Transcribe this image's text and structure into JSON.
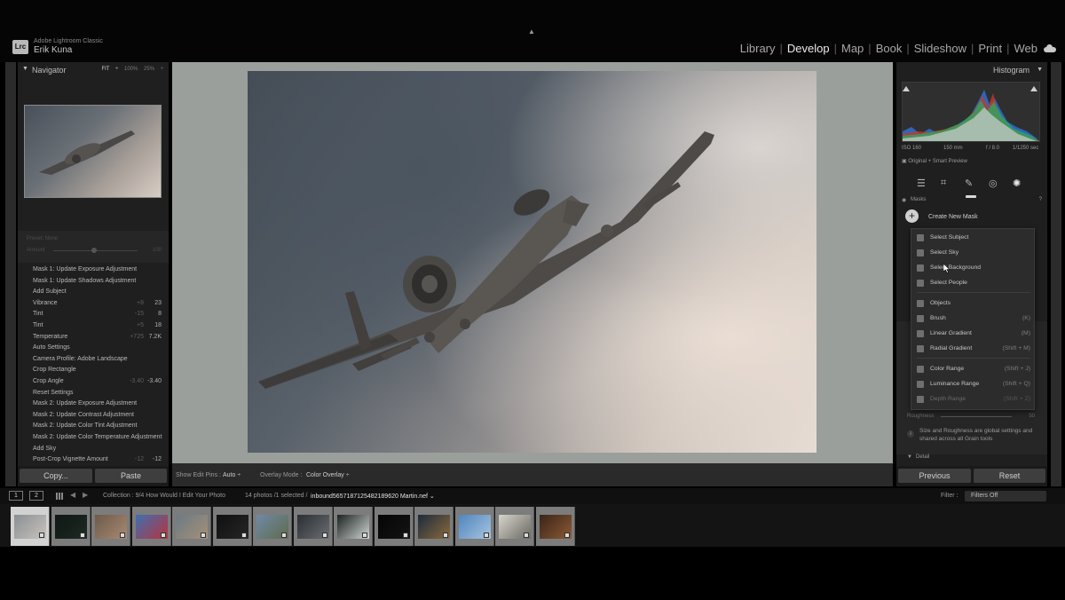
{
  "app": {
    "logo_text": "Lrc",
    "app_name": "Adobe Lightroom Classic",
    "user_name": "Erik Kuna",
    "top_arrow": "▲"
  },
  "modules": [
    "Library",
    "Develop",
    "Map",
    "Book",
    "Slideshow",
    "Print",
    "Web"
  ],
  "active_module": "Develop",
  "navigator": {
    "title": "Navigator",
    "zoom_fit": "FIT ÷",
    "zoom_100": "100%",
    "zoom_25": "25%"
  },
  "dimmed": {
    "preset": "Preset: None",
    "amount_label": "Amount",
    "amount_value": "100"
  },
  "history": [
    {
      "label": "Mask 1: Update Exposure Adjustment",
      "v1": "",
      "v2": ""
    },
    {
      "label": "Mask 1: Update Shadows Adjustment",
      "v1": "",
      "v2": ""
    },
    {
      "label": "Add Subject",
      "v1": "",
      "v2": ""
    },
    {
      "label": "Vibrance",
      "v1": "+8",
      "v2": "23"
    },
    {
      "label": "Tint",
      "v1": "-15",
      "v2": "8"
    },
    {
      "label": "Tint",
      "v1": "+5",
      "v2": "18"
    },
    {
      "label": "Temperature",
      "v1": "+725",
      "v2": "7.2K"
    },
    {
      "label": "Auto Settings",
      "v1": "",
      "v2": ""
    },
    {
      "label": "Camera Profile: Adobe Landscape",
      "v1": "",
      "v2": ""
    },
    {
      "label": "Crop Rectangle",
      "v1": "",
      "v2": ""
    },
    {
      "label": "Crop Angle",
      "v1": "-3.40",
      "v2": "-3.40"
    },
    {
      "label": "Reset Settings",
      "v1": "",
      "v2": ""
    },
    {
      "label": "Mask 2: Update Exposure Adjustment",
      "v1": "",
      "v2": ""
    },
    {
      "label": "Mask 2: Update Contrast Adjustment",
      "v1": "",
      "v2": ""
    },
    {
      "label": "Mask 2: Update Color Tint Adjustment",
      "v1": "",
      "v2": ""
    },
    {
      "label": "Mask 2: Update Color Temperature Adjustment",
      "v1": "",
      "v2": ""
    },
    {
      "label": "Add Sky",
      "v1": "",
      "v2": ""
    },
    {
      "label": "Post-Crop Vignette Amount",
      "v1": "-12",
      "v2": "-12"
    }
  ],
  "left_buttons": {
    "copy": "Copy...",
    "paste": "Paste"
  },
  "center_toolbar": {
    "show_edit_pins_label": "Show Edit Pins :",
    "show_edit_pins_value": "Auto ÷",
    "overlay_mode_label": "Overlay Mode :",
    "overlay_mode_value": "Color Overlay ÷"
  },
  "histogram": {
    "title": "Histogram",
    "iso": "ISO 160",
    "focal": "150 mm",
    "aperture": "f / 8.0",
    "shutter": "1/1250 sec",
    "preview_mode": "Original + Smart Preview"
  },
  "tools": [
    "edit-sliders-icon",
    "crop-icon",
    "heal-icon",
    "redeye-icon",
    "masking-icon"
  ],
  "masks": {
    "header": "Masks",
    "create_new_mask": "Create New Mask"
  },
  "mask_menu": [
    {
      "label": "Select Subject",
      "shortcut": "",
      "enabled": true,
      "icon": "subject-icon"
    },
    {
      "label": "Select Sky",
      "shortcut": "",
      "enabled": true,
      "icon": "sky-icon"
    },
    {
      "label": "Select Background",
      "shortcut": "",
      "enabled": true,
      "icon": "background-icon"
    },
    {
      "label": "Select People",
      "shortcut": "",
      "enabled": true,
      "icon": "people-icon"
    },
    {
      "label": "Objects",
      "shortcut": "",
      "enabled": true,
      "icon": "objects-icon"
    },
    {
      "label": "Brush",
      "shortcut": "(K)",
      "enabled": true,
      "icon": "brush-icon"
    },
    {
      "label": "Linear Gradient",
      "shortcut": "(M)",
      "enabled": true,
      "icon": "linear-gradient-icon"
    },
    {
      "label": "Radial Gradient",
      "shortcut": "(Shift + M)",
      "enabled": true,
      "icon": "radial-gradient-icon"
    },
    {
      "label": "Color Range",
      "shortcut": "(Shift + J)",
      "enabled": true,
      "icon": "color-range-icon"
    },
    {
      "label": "Luminance Range",
      "shortcut": "(Shift + Q)",
      "enabled": true,
      "icon": "luminance-range-icon"
    },
    {
      "label": "Depth Range",
      "shortcut": "(Shift + Z)",
      "enabled": false,
      "icon": "depth-range-icon"
    }
  ],
  "grain": {
    "roughness_label": "Roughness",
    "roughness_value": "50",
    "note": "Size and Roughness are global settings and shared across all Grain tools"
  },
  "detail_header": "Detail",
  "right_buttons": {
    "previous": "Previous",
    "reset": "Reset"
  },
  "film_bar": {
    "screen1": "1",
    "screen2": "2",
    "collection": "Collection : 9/4 How Would I Edit Your Photo",
    "count": "14 photos /1 selected /",
    "file": "inbound5657187125482189620 Martin.nef ⌄",
    "filter_label": "Filter :",
    "filter_value": "Filters Off"
  },
  "filmstrip": [
    {
      "colors": [
        "#8a8f93",
        "#c9c3bd"
      ],
      "selected": true
    },
    {
      "colors": [
        "#0f1714",
        "#1d2a22"
      ],
      "selected": false
    },
    {
      "colors": [
        "#6d5a4c",
        "#a88a70"
      ],
      "selected": false
    },
    {
      "colors": [
        "#3f6fb2",
        "#b8333b"
      ],
      "selected": false
    },
    {
      "colors": [
        "#6c7a85",
        "#a49078"
      ],
      "selected": false
    },
    {
      "colors": [
        "#101010",
        "#262626"
      ],
      "selected": false
    },
    {
      "colors": [
        "#6f8aa6",
        "#5f6b4c"
      ],
      "selected": false
    },
    {
      "colors": [
        "#2a2f33",
        "#6a6e72"
      ],
      "selected": false
    },
    {
      "colors": [
        "#1b2320",
        "#cfd5d2"
      ],
      "selected": false
    },
    {
      "colors": [
        "#050505",
        "#141414"
      ],
      "selected": false
    },
    {
      "colors": [
        "#1d2b3c",
        "#8a6a3c"
      ],
      "selected": false
    },
    {
      "colors": [
        "#4f86c1",
        "#a7c3dd"
      ],
      "selected": false
    },
    {
      "colors": [
        "#d8d4cc",
        "#6a6a62"
      ],
      "selected": false
    },
    {
      "colors": [
        "#3a2418",
        "#8c5a34"
      ],
      "selected": false
    }
  ]
}
